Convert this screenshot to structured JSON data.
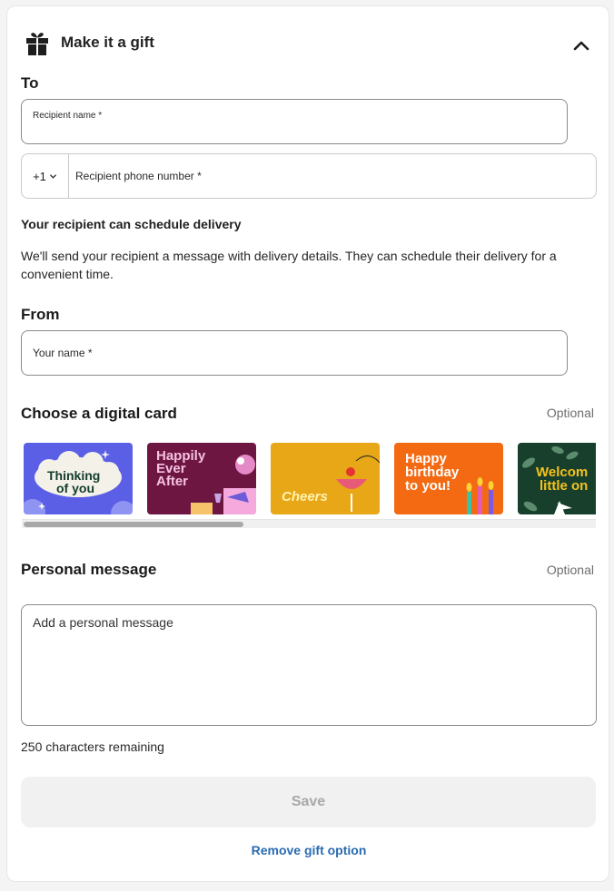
{
  "header": {
    "title": "Make it a gift",
    "icon": "gift-icon",
    "collapse_icon": "chevron-up-icon"
  },
  "to": {
    "label": "To",
    "recipient_name_label": "Recipient name *",
    "country_code": "+1",
    "phone_placeholder": "Recipient phone number *"
  },
  "schedule": {
    "heading": "Your recipient can schedule delivery",
    "body": "We'll send your recipient a message with delivery details. They can schedule their delivery for a convenient time."
  },
  "from": {
    "label": "From",
    "your_name_label": "Your name *"
  },
  "digital_card": {
    "heading": "Choose a digital card",
    "optional": "Optional",
    "cards": [
      {
        "text_line1": "Thinking",
        "text_line2": "of you",
        "bg": "#5b5fe6"
      },
      {
        "text_line1": "Happily",
        "text_line2": "Ever",
        "text_line3": "After",
        "bg": "#6e1642"
      },
      {
        "text_line1": "Cheers",
        "bg": "#e8a716"
      },
      {
        "text_line1": "Happy",
        "text_line2": "birthday",
        "text_line3": "to you!",
        "bg": "#f36a12"
      },
      {
        "text_line1": "Welcom",
        "text_line2": "little on",
        "bg": "#173f2c"
      }
    ]
  },
  "personal_message": {
    "heading": "Personal message",
    "optional": "Optional",
    "placeholder": "Add a personal message",
    "remaining": "250 characters remaining"
  },
  "actions": {
    "save": "Save",
    "remove": "Remove gift option"
  },
  "colors": {
    "link": "#2a6bb0",
    "disabled_bg": "#f1f1f1",
    "disabled_text": "#a8a8a8"
  }
}
